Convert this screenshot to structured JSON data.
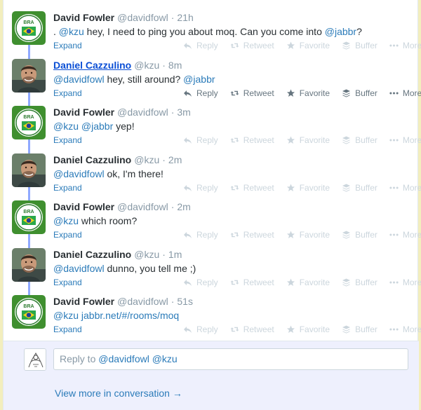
{
  "tweets": [
    {
      "name": "David Fowler",
      "handle": "@davidfowl",
      "time": "21h",
      "segments": [
        {
          "text": ". ",
          "mention": false
        },
        {
          "text": "@kzu",
          "mention": true
        },
        {
          "text": " hey, I need to ping you about moq. Can you come into ",
          "mention": false
        },
        {
          "text": "@jabbr",
          "mention": true
        },
        {
          "text": "?",
          "mention": false
        }
      ],
      "avatar": "bra-badge",
      "hovered": false
    },
    {
      "name": "Daniel Cazzulino",
      "handle": "@kzu",
      "time": "8m",
      "segments": [
        {
          "text": "@davidfowl",
          "mention": true
        },
        {
          "text": " hey, still around? ",
          "mention": false
        },
        {
          "text": "@jabbr",
          "mention": true
        }
      ],
      "avatar": "person-photo",
      "hovered": true
    },
    {
      "name": "David Fowler",
      "handle": "@davidfowl",
      "time": "3m",
      "segments": [
        {
          "text": "@kzu",
          "mention": true
        },
        {
          "text": " ",
          "mention": false
        },
        {
          "text": "@jabbr",
          "mention": true
        },
        {
          "text": " yep!",
          "mention": false
        }
      ],
      "avatar": "bra-badge",
      "hovered": false
    },
    {
      "name": "Daniel Cazzulino",
      "handle": "@kzu",
      "time": "2m",
      "segments": [
        {
          "text": "@davidfowl",
          "mention": true
        },
        {
          "text": " ok, I'm there!",
          "mention": false
        }
      ],
      "avatar": "person-photo",
      "hovered": false
    },
    {
      "name": "David Fowler",
      "handle": "@davidfowl",
      "time": "2m",
      "segments": [
        {
          "text": "@kzu",
          "mention": true
        },
        {
          "text": " which room?",
          "mention": false
        }
      ],
      "avatar": "bra-badge",
      "hovered": false
    },
    {
      "name": "Daniel Cazzulino",
      "handle": "@kzu",
      "time": "1m",
      "segments": [
        {
          "text": "@davidfowl",
          "mention": true
        },
        {
          "text": " dunno, you tell me ;)",
          "mention": false
        }
      ],
      "avatar": "person-photo",
      "hovered": false
    },
    {
      "name": "David Fowler",
      "handle": "@davidfowl",
      "time": "51s",
      "segments": [
        {
          "text": "@kzu",
          "mention": true
        },
        {
          "text": " jabbr.net/#/rooms/moq",
          "mention": true
        }
      ],
      "avatar": "bra-badge",
      "hovered": false
    }
  ],
  "labels": {
    "expand": "Expand",
    "reply": "Reply",
    "retweet": "Retweet",
    "favorite": "Favorite",
    "buffer": "Buffer",
    "more": "More",
    "dot": "·",
    "badge_text": "BRA"
  },
  "reply_box": {
    "prefix": "Reply to ",
    "mentions": "@davidfowl @kzu"
  },
  "view_more": "View more in conversation →",
  "colors": {
    "link": "#2b7bb9",
    "connector": "#8fa9ff",
    "reply_bg": "#eef0fd",
    "badge_green": "#2e7d32"
  }
}
